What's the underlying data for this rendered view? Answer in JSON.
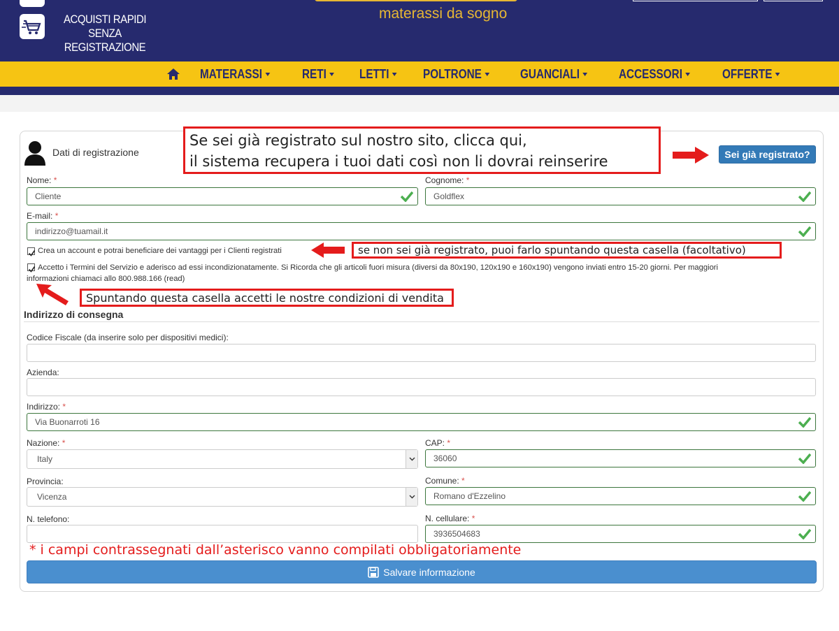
{
  "header": {
    "promo_line1": "ACQUISTI RAPIDI",
    "promo_line2": "SENZA REGISTRAZIONE",
    "tagline": "materassi da sogno",
    "icons": [
      "cart-icon",
      "home-icon"
    ]
  },
  "nav": {
    "items": [
      "MATERASSI",
      "RETI",
      "LETTI",
      "POLTRONE",
      "GUANCIALI",
      "ACCESSORI",
      "OFFERTE"
    ]
  },
  "form": {
    "title": "Dati di registrazione",
    "registered_button": "Sei già registrato?",
    "nome_label": "Nome:",
    "nome_value": "Cliente",
    "cognome_label": "Cognome:",
    "cognome_value": "Goldflex",
    "email_label": "E-mail:",
    "email_value": "indirizzo@tuamail.it",
    "account_checkbox": "Crea un account e potrai beneficiare dei vantaggi per i Clienti registrati",
    "terms_line1": "Accetto i Termini del Servizio e aderisco ad essi incondizionatamente. Si Ricorda che gli articoli fuori misura (diversi da 80x190, 120x190 e 160x190) vengono inviati entro 15-20 giorni. Per maggiori",
    "terms_line2": "informazioni chiamaci allo 800.988.166 (read)",
    "section_title": "Indirizzo di consegna",
    "cf_label": "Codice Fiscale (da inserire solo per dispositivi medici):",
    "azienda_label": "Azienda:",
    "indirizzo_label": "Indirizzo:",
    "indirizzo_value": "Via Buonarroti 16",
    "nazione_label": "Nazione:",
    "nazione_value": "Italy",
    "cap_label": "CAP:",
    "cap_value": "36060",
    "provincia_label": "Provincia:",
    "provincia_value": "Vicenza",
    "comune_label": "Comune:",
    "comune_value": "Romano d'Ezzelino",
    "telefono_label": "N. telefono:",
    "cellulare_label": "N. cellulare:",
    "cellulare_value": "3936504683",
    "required_mark": "*",
    "save_button": "Salvare informazione"
  },
  "annotations": {
    "a1_line1": "Se sei già registrato sul nostro sito, clicca qui,",
    "a1_line2": "il sistema recupera i tuoi dati così non li dovrai reinserire",
    "a2": "se non sei già registrato, puoi farlo spuntando questa casella (facoltativo)",
    "a3": "Spuntando questa casella accetti le nostre condizioni di vendita",
    "note": "* i campi contrassegnati dall’asterisco vanno compilati obbligatoriamente"
  },
  "colors": {
    "brand_navy": "#262a6e",
    "brand_yellow": "#f6c413",
    "valid_green": "#3c763d",
    "annotation_red": "#e41c1c",
    "primary_blue": "#337ab7"
  }
}
